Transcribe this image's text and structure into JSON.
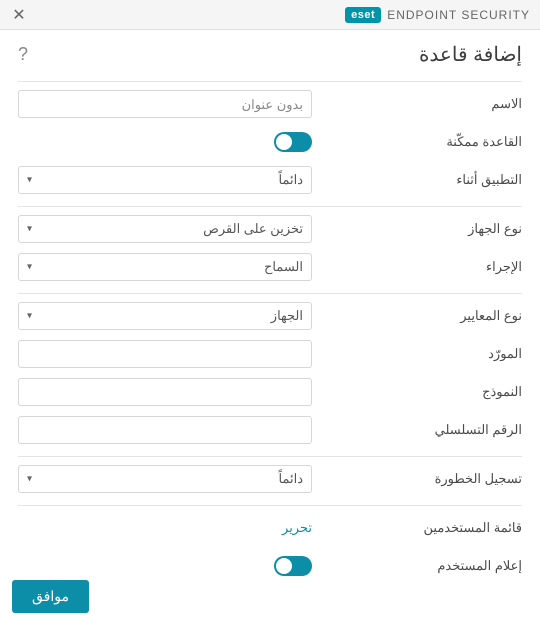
{
  "titlebar": {
    "brand_badge": "eset",
    "brand_text": "ENDPOINT SECURITY"
  },
  "heading": "إضافة قاعدة",
  "help_glyph": "?",
  "close_glyph": "✕",
  "sections": {
    "general": {
      "name_label": "الاسم",
      "name_placeholder": "بدون عنوان",
      "name_value": "",
      "enabled_label": "القاعدة ممكّنة",
      "apply_label": "التطبيق أثناء",
      "apply_value": "دائماً"
    },
    "device": {
      "type_label": "نوع الجهاز",
      "type_value": "تخزين على القرص",
      "action_label": "الإجراء",
      "action_value": "السماح"
    },
    "criteria": {
      "crit_type_label": "نوع المعايير",
      "crit_type_value": "الجهاز",
      "vendor_label": "المورّد",
      "vendor_value": "",
      "model_label": "النموذج",
      "model_value": "",
      "serial_label": "الرقم التسلسلي",
      "serial_value": ""
    },
    "severity": {
      "severity_label": "تسجيل الخطورة",
      "severity_value": "دائماً"
    },
    "users": {
      "userlist_label": "قائمة المستخدمين",
      "edit_link": "تحرير",
      "notify_label": "إعلام المستخدم"
    }
  },
  "footer": {
    "ok_label": "موافق"
  }
}
